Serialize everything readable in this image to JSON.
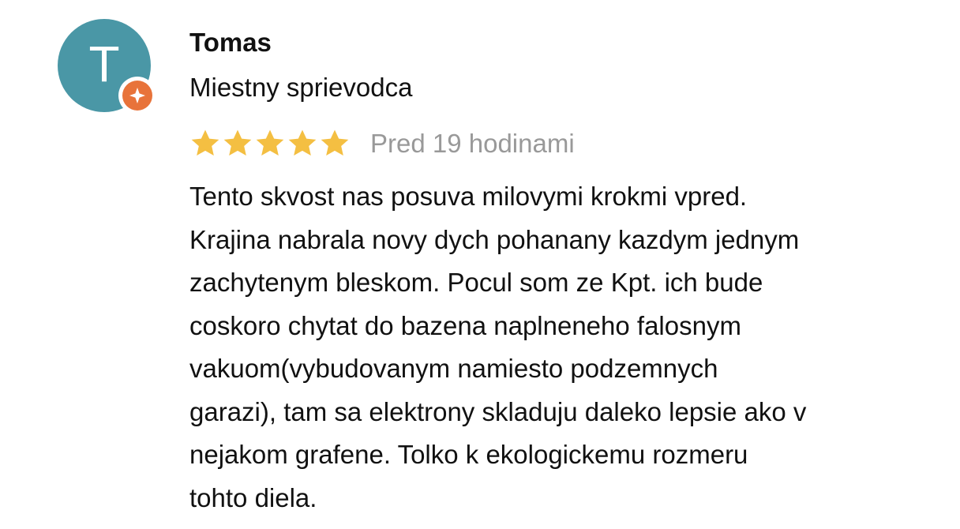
{
  "review": {
    "author": {
      "avatar_letter": "T",
      "name": "Tomas",
      "subtitle": "Miestny sprievodca",
      "badge_icon": "local-guide-icon"
    },
    "rating": {
      "stars": 5,
      "max_stars": 5,
      "star_icon": "star-icon",
      "timestamp": "Pred 19 hodinami"
    },
    "text_lines": [
      "Tento skvost nas posuva milovymi krokmi vpred.",
      "Krajina nabrala novy dych pohanany kazdym jednym",
      "zachytenym bleskom. Pocul som ze Kpt. ich bude",
      "coskoro chytat do bazena naplneneho falosnym",
      "vakuom(vybudovanym namiesto podzemnych",
      "garazi), tam sa elektrony skladuju daleko lepsie ako v",
      "nejakom grafene. Tolko k ekologickemu rozmeru",
      "tohto diela."
    ]
  },
  "colors": {
    "avatar_bg": "#4a97a6",
    "badge_orange": "#e8733a",
    "star_gold": "#f4bf42",
    "timestamp_gray": "#999999",
    "text": "#111111"
  }
}
